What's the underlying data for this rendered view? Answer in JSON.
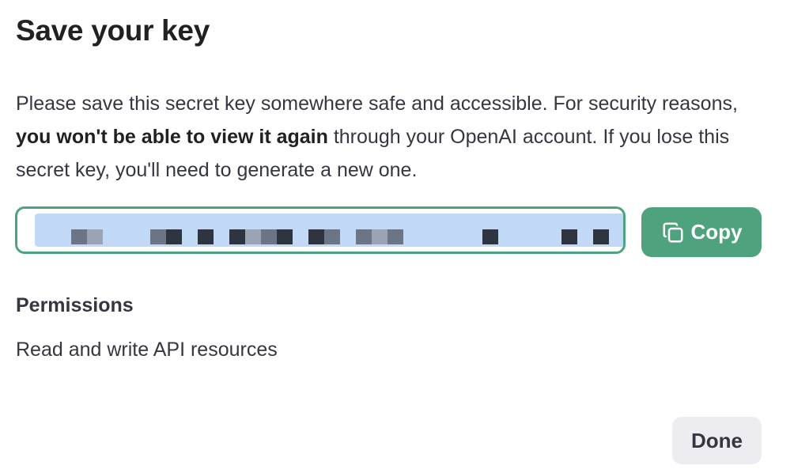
{
  "dialog": {
    "title": "Save your key",
    "description": {
      "before": "Please save this secret key somewhere safe and accessible. For security reasons, ",
      "emphasis": "you won't be able to view it again",
      "after": " through your OpenAI account. If you lose this secret key, you'll need to generate a new one."
    },
    "secret_key": {
      "value": "",
      "redacted": true
    },
    "copy_button": {
      "label": "Copy",
      "icon": "copy-icon"
    },
    "permissions": {
      "label": "Permissions",
      "value": "Read and write API resources"
    },
    "done_button": {
      "label": "Done"
    }
  },
  "colors": {
    "accent": "#4ea37e",
    "redaction": "#c2d8f7",
    "secondary_button": "#ececf1",
    "text": "#353740"
  }
}
